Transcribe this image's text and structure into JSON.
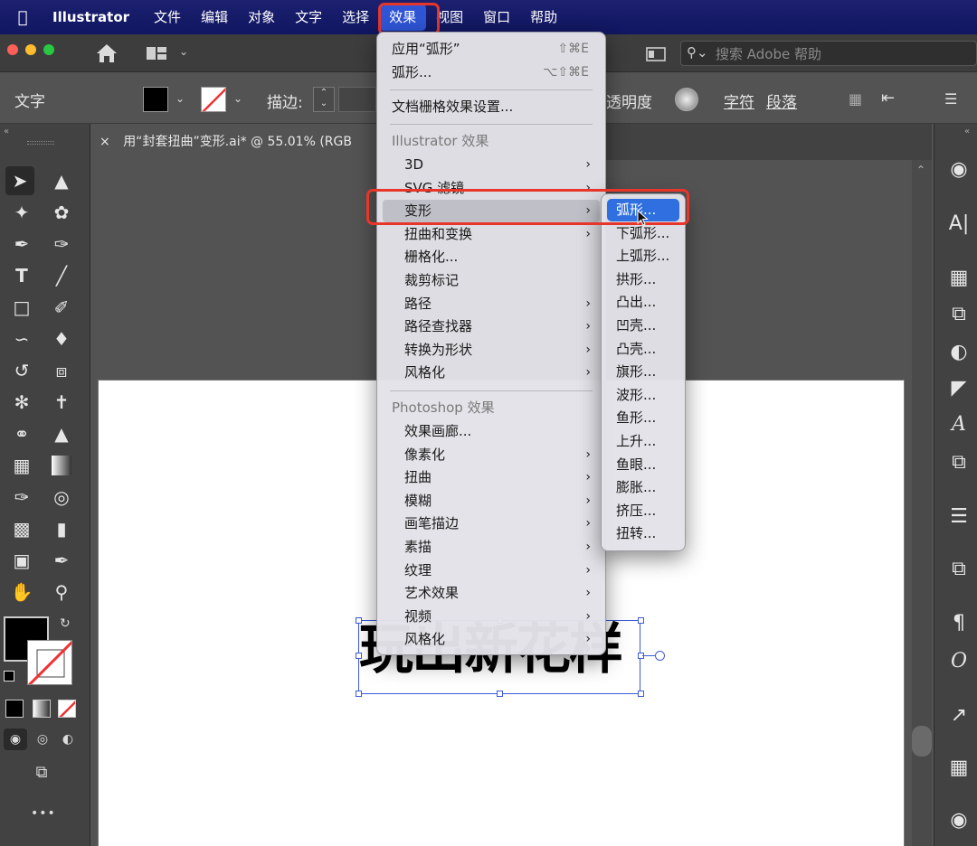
{
  "menubar": {
    "items": [
      "Illustrator",
      "文件",
      "编辑",
      "对象",
      "文字",
      "选择",
      "效果",
      "视图",
      "窗口",
      "帮助"
    ],
    "active": "效果"
  },
  "appbar": {
    "search_placeholder": "搜索 Adobe 帮助"
  },
  "controlbar": {
    "mode_label": "文字",
    "stroke_label": "描边:",
    "opacity_label": "透明度",
    "char_label": "字符",
    "para_label": "段落"
  },
  "document": {
    "tab_title": "用“封套扭曲”变形.ai* @ 55.01% (RGB"
  },
  "canvas": {
    "artwork_text": "玩出新花样"
  },
  "effect_menu": {
    "top_items": [
      {
        "label": "应用“弧形”",
        "shortcut": "⇧⌘E"
      },
      {
        "label": "弧形...",
        "shortcut": "⌥⇧⌘E"
      }
    ],
    "raster_settings": "文档栅格效果设置...",
    "illustrator_header": "Illustrator 效果",
    "illustrator_items": [
      {
        "label": "3D",
        "submenu": true
      },
      {
        "label": "SVG 滤镜",
        "submenu": true
      },
      {
        "label": "变形",
        "submenu": true
      },
      {
        "label": "扭曲和变换",
        "submenu": true
      },
      {
        "label": "栅格化...",
        "submenu": false
      },
      {
        "label": "裁剪标记",
        "submenu": false
      },
      {
        "label": "路径",
        "submenu": true
      },
      {
        "label": "路径查找器",
        "submenu": true
      },
      {
        "label": "转换为形状",
        "submenu": true
      },
      {
        "label": "风格化",
        "submenu": true
      }
    ],
    "photoshop_header": "Photoshop 效果",
    "photoshop_items": [
      {
        "label": "效果画廊...",
        "submenu": false
      },
      {
        "label": "像素化",
        "submenu": true
      },
      {
        "label": "扭曲",
        "submenu": true
      },
      {
        "label": "模糊",
        "submenu": true
      },
      {
        "label": "画笔描边",
        "submenu": true
      },
      {
        "label": "素描",
        "submenu": true
      },
      {
        "label": "纹理",
        "submenu": true
      },
      {
        "label": "艺术效果",
        "submenu": true
      },
      {
        "label": "视频",
        "submenu": true
      },
      {
        "label": "风格化",
        "submenu": true
      }
    ],
    "highlighted": "变形"
  },
  "warp_submenu": {
    "items": [
      "弧形...",
      "下弧形...",
      "上弧形...",
      "拱形...",
      "凸出...",
      "凹壳...",
      "凸壳...",
      "旗形...",
      "波形...",
      "鱼形...",
      "上升...",
      "鱼眼...",
      "膨胀...",
      "挤压...",
      "扭转..."
    ],
    "selected": "弧形..."
  },
  "icons": {
    "submenu_arrow": "›",
    "close_tab": "×",
    "more_tools": "•••"
  },
  "colors": {
    "menubar_bg": "#101660",
    "selection_blue": "#2f6fe0",
    "annotation_red": "#e8352a",
    "panel_dark": "#424242",
    "canvas_gray": "#535353"
  }
}
